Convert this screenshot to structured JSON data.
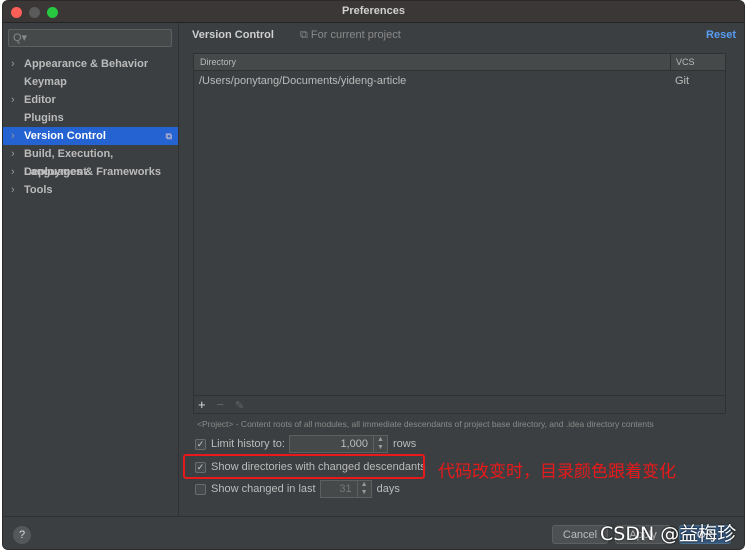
{
  "window": {
    "title": "Preferences"
  },
  "sidebar": {
    "search_placeholder": "Q▾",
    "items": [
      {
        "label": "Appearance & Behavior",
        "expandable": true
      },
      {
        "label": "Keymap",
        "expandable": false
      },
      {
        "label": "Editor",
        "expandable": true
      },
      {
        "label": "Plugins",
        "expandable": false
      },
      {
        "label": "Version Control",
        "expandable": true,
        "selected": true
      },
      {
        "label": "Build, Execution, Deployment",
        "expandable": true
      },
      {
        "label": "Languages & Frameworks",
        "expandable": true
      },
      {
        "label": "Tools",
        "expandable": true
      }
    ]
  },
  "main": {
    "title": "Version Control",
    "scope": "For current project",
    "reset": "Reset",
    "table": {
      "headers": [
        "Directory",
        "VCS"
      ],
      "rows": [
        {
          "directory": "/Users/ponytang/Documents/yideng-article",
          "vcs": "Git"
        }
      ],
      "tools": {
        "add": "+",
        "remove": "−",
        "edit": "✎"
      }
    },
    "note": "<Project> - Content roots of all modules, all immediate descendants of project base directory, and .idea directory contents",
    "limit_history": {
      "label": "Limit history to:",
      "checked": true,
      "value": "1,000",
      "unit": "rows"
    },
    "show_dirs": {
      "label": "Show directories with changed descendants",
      "checked": true
    },
    "show_changed": {
      "label": "Show changed in last",
      "checked": false,
      "value": "31",
      "unit": "days"
    }
  },
  "annotation": "代码改变时，目录颜色跟着变化",
  "footer": {
    "help": "?",
    "cancel": "Cancel",
    "apply": "Apply",
    "ok": "OK"
  },
  "watermark": "CSDN @益梅珍",
  "colors": {
    "accent": "#2463d1",
    "link": "#589df6",
    "annotation": "#e8191b"
  }
}
